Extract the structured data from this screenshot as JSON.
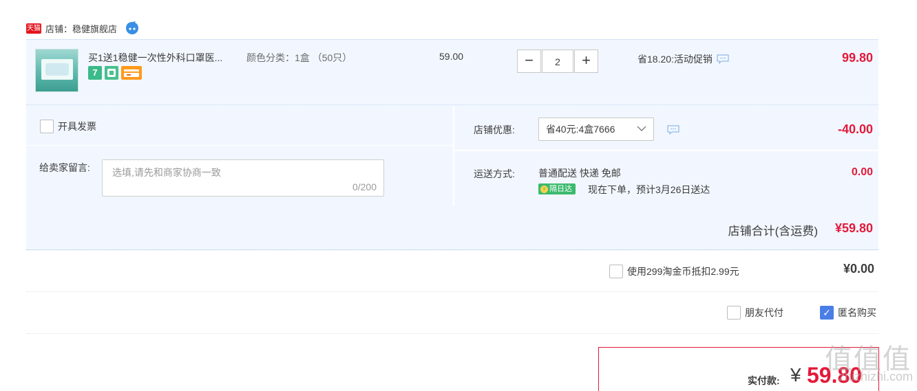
{
  "shop": {
    "badge": "天猫",
    "name": "店铺：稳健旗舰店"
  },
  "item": {
    "title": "买1送1稳健一次性外科口罩医...",
    "sku": "颜色分类：1盒 （50只）",
    "unit_price": "59.00",
    "quantity": "2",
    "qty_minus": "−",
    "qty_plus": "+",
    "promo": "省18.20:活动促销",
    "subtotal": "99.80",
    "tags": [
      "7",
      "保",
      "卡"
    ]
  },
  "invoice": {
    "label": "开具发票"
  },
  "message": {
    "label": "给卖家留言:",
    "placeholder": "选填,请先和商家协商一致",
    "count": "0/200"
  },
  "shop_discount": {
    "label": "店铺优惠:",
    "selected": "省40元:4盒7666",
    "amount": "-40.00"
  },
  "shipping": {
    "label": "运送方式:",
    "method": "普通配送 快递 免邮",
    "tag": "隔日达",
    "eta": "现在下单，预计3月26日送达",
    "fee": "0.00"
  },
  "shop_total": {
    "label": "店铺合计(含运费)",
    "amount": "¥59.80"
  },
  "coins": {
    "label": "使用299淘金币抵扣2.99元",
    "amount": "¥0.00"
  },
  "options": {
    "friend_pay": "朋友代付",
    "anonymous": "匿名购买",
    "anonymous_checked": true
  },
  "payment": {
    "label": "实付款:",
    "currency": "¥",
    "amount": "59.80"
  },
  "watermark": {
    "text": "值值值",
    "site": "zhizhizhi.com"
  },
  "colors": {
    "price_red": "#e4193a",
    "panel_bg": "#f2f7ff",
    "check_blue": "#4a7ee7"
  }
}
